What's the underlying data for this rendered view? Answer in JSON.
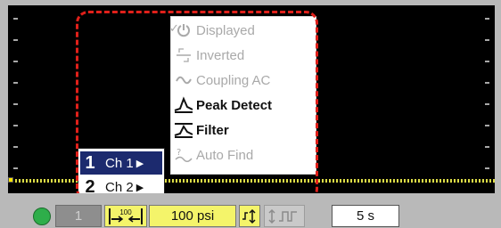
{
  "menu": {
    "items": [
      {
        "label": "Displayed",
        "icon": "power-icon",
        "enabled": false,
        "checked": true
      },
      {
        "label": "Inverted",
        "icon": "invert-icon",
        "enabled": false,
        "checked": false
      },
      {
        "label": "Coupling AC",
        "icon": "ac-wave-icon",
        "enabled": false,
        "checked": false
      },
      {
        "label": "Peak Detect",
        "icon": "peak-detect-icon",
        "enabled": true,
        "checked": false
      },
      {
        "label": "Filter",
        "icon": "filter-icon",
        "enabled": true,
        "checked": false
      },
      {
        "label": "Auto Find",
        "icon": "auto-find-icon",
        "enabled": false,
        "checked": false
      }
    ]
  },
  "channel_menu": {
    "items": [
      {
        "number": "1",
        "label": "Ch 1",
        "arrow": "▶",
        "selected": true
      },
      {
        "number": "2",
        "label": "Ch 2",
        "arrow": "▶",
        "selected": false
      }
    ]
  },
  "bottom_bar": {
    "channel_button": "1",
    "scale_label": "100",
    "range_label": "100 psi",
    "time_label": "5 s"
  },
  "colors": {
    "highlight": "#e0201a",
    "selected_bg": "#1c2a6e",
    "status_led": "#2eae4a",
    "button_yellow": "#f4f46a"
  }
}
